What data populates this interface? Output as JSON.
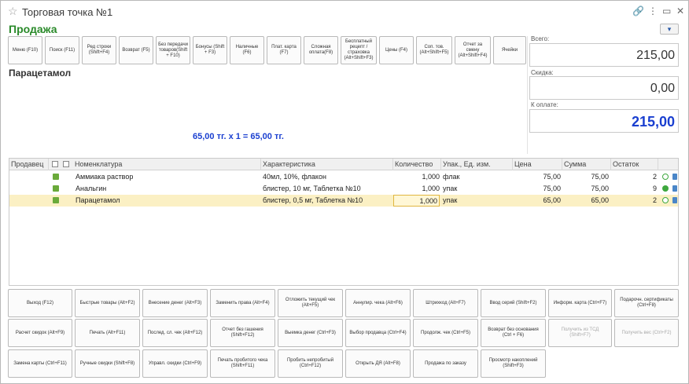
{
  "window": {
    "title": "Торговая точка №1",
    "controls": [
      "🔗",
      "⋮",
      "▭",
      "✕"
    ]
  },
  "mode": "Продажа",
  "help_label": "▾",
  "top_buttons": [
    "Меню (F10)",
    "Поиск (F11)",
    "Ред строки (Shift+F4)",
    "Возврат (F5)",
    "Без передачи товаров(Shift + F10)",
    "Бонусы (Shift + F3)",
    "Наличные (F6)",
    "Плат. карта (F7)",
    "Сложная оплата(F8)",
    "Бесплатный рецепт / страховка (Alt+Shift+F3)",
    "Цены (F4)",
    "Соп. тов. (Alt+Shift+F5)",
    "Отчет за смену (Alt+Shift+F4)",
    "Ячейки"
  ],
  "totals": {
    "total_label": "Всего:",
    "total_value": "215,00",
    "discount_label": "Скидка:",
    "discount_value": "0,00",
    "pay_label": "К оплате:",
    "pay_value": "215,00"
  },
  "current_product": "Парацетамол",
  "calc_line": "65,00 тг. х 1  = 65,00 тг.",
  "table": {
    "columns": [
      "Продавец",
      "Номенклатура",
      "Характеристика",
      "Количество",
      "Упак., Ед. изм.",
      "Цена",
      "Сумма",
      "Остаток"
    ],
    "rows": [
      {
        "name": "Аммиака раствор",
        "char": "40мл, 10%, флакон",
        "qty": "1,000",
        "unit": "флак",
        "price": "75,00",
        "sum": "75,00",
        "stock": "2"
      },
      {
        "name": "Анальгин",
        "char": "блистер, 10 мг, Таблетка №10",
        "qty": "1,000",
        "unit": "упак",
        "price": "75,00",
        "sum": "75,00",
        "stock": "9"
      },
      {
        "name": "Парацетамол",
        "char": "блистер, 0,5 мг, Таблетка №10",
        "qty": "1,000",
        "unit": "упак",
        "price": "65,00",
        "sum": "65,00",
        "stock": "2"
      }
    ]
  },
  "bottom_buttons": [
    [
      "Выход (F12)",
      "Быстрые товары (Alt+F2)",
      "Внесение денег (Alt+F3)",
      "Заменить права (Alt+F4)",
      "Отложить текущий чек (Alt+F5)",
      "Аннулир. чека (Alt+F6)",
      "Штрихкод (Alt+F7)",
      "Ввод серий (Shift+F2)",
      "Информ. карта (Ctrl+F7)",
      "Подарочн. сертификаты (Ctrl+F8)"
    ],
    [
      "Расчет скидок (Alt+F9)",
      "Печать (Alt+F11)",
      "Послед. сл. чек (Alt+F12)",
      "Отчет без гашения (Shift+F12)",
      "Выемка денег (Ctrl+F3)",
      "Выбор продавца (Ctrl+F4)",
      "Продолж. чек (Ctrl+F5)",
      "Возврат без основания (Ctrl + F6)",
      "Получить из ТСД (Shift+F7)",
      "Получить вес (Ctrl+F2)"
    ],
    [
      "Замена карты (Ctrl+F11)",
      "Ручные скидки (Shift+F8)",
      "Управл. скидки (Ctrl+F9)",
      "Печать пробитого чека (Shift+F11)",
      "Пробить непробитый (Ctrl+F12)",
      "Открыть ДЯ (Alt+F8)",
      "Продажа по заказу",
      "Просмотр накоплений (Shift+F3)"
    ]
  ]
}
